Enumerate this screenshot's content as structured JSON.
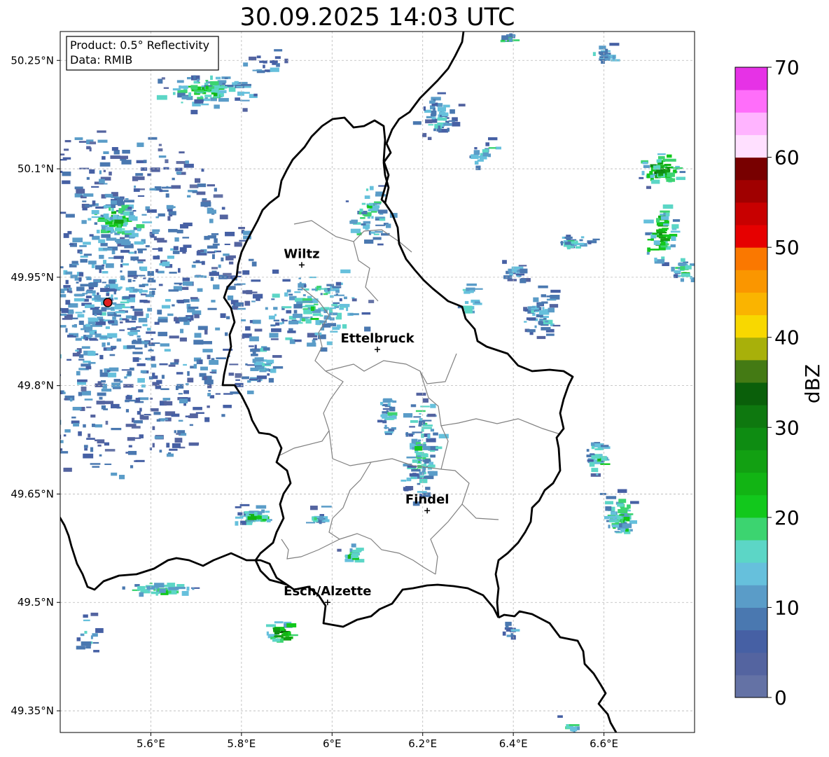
{
  "title": "30.09.2025 14:03 UTC",
  "info_box": {
    "product": "Product: 0.5° Reflectivity",
    "data": "Data: RMIB"
  },
  "map": {
    "lon_range": [
      5.4,
      6.8
    ],
    "lat_range": [
      49.32,
      50.29
    ],
    "lat_ticks": [
      {
        "value": 50.25,
        "label": "50.25°N"
      },
      {
        "value": 50.1,
        "label": "50.1°N"
      },
      {
        "value": 49.95,
        "label": "49.95°N"
      },
      {
        "value": 49.8,
        "label": "49.8°N"
      },
      {
        "value": 49.65,
        "label": "49.65°N"
      },
      {
        "value": 49.5,
        "label": "49.5°N"
      },
      {
        "value": 49.35,
        "label": "49.35°N"
      }
    ],
    "lon_ticks": [
      {
        "value": 5.6,
        "label": "5.6°E"
      },
      {
        "value": 5.8,
        "label": "5.8°E"
      },
      {
        "value": 6.0,
        "label": "6°E"
      },
      {
        "value": 6.2,
        "label": "6.2°E"
      },
      {
        "value": 6.4,
        "label": "6.4°E"
      },
      {
        "value": 6.6,
        "label": "6.6°E"
      }
    ],
    "gridlines": true,
    "radar_site": {
      "lon": 5.505,
      "lat": 49.915,
      "color": "#e02020"
    },
    "cities": [
      {
        "name": "Wiltz",
        "lon": 5.933,
        "lat": 49.967
      },
      {
        "name": "Ettelbruck",
        "lon": 6.1,
        "lat": 49.85
      },
      {
        "name": "Findel",
        "lon": 6.21,
        "lat": 49.627
      },
      {
        "name": "Esch/Alzette",
        "lon": 5.99,
        "lat": 49.5
      }
    ]
  },
  "colorbar": {
    "label": "dBZ",
    "min": 0,
    "max": 70,
    "ticks": [
      {
        "value": 0,
        "label": "0"
      },
      {
        "value": 10,
        "label": "10"
      },
      {
        "value": 20,
        "label": "20"
      },
      {
        "value": 30,
        "label": "30"
      },
      {
        "value": 40,
        "label": "40"
      },
      {
        "value": 50,
        "label": "50"
      },
      {
        "value": 60,
        "label": "60"
      },
      {
        "value": 70,
        "label": "70"
      }
    ],
    "colors": [
      "#6472a5",
      "#5464a0",
      "#4660a4",
      "#4a78b0",
      "#5a9cc8",
      "#66c0dc",
      "#5cd6c6",
      "#3cd470",
      "#12c81c",
      "#12b414",
      "#12a012",
      "#0e8c12",
      "#0e780f",
      "#0a5f0a",
      "#447a14",
      "#a8b00a",
      "#f8d800",
      "#fab400",
      "#fa9600",
      "#fa7800",
      "#e60000",
      "#c80000",
      "#a00000",
      "#780000",
      "#ffe0ff",
      "#ffb4ff",
      "#ff6efa",
      "#e632e6"
    ]
  },
  "echo_clusters": [
    {
      "lon": 5.505,
      "lat": 49.915,
      "r_lon": 0.33,
      "r_lat": 0.24,
      "count": 1100,
      "intensity": 0.15,
      "min_r": 0.25
    },
    {
      "lon": 5.72,
      "lat": 50.21,
      "r_lon": 0.12,
      "r_lat": 0.03,
      "count": 110,
      "intensity": 0.35
    },
    {
      "lon": 5.52,
      "lat": 50.03,
      "r_lon": 0.08,
      "r_lat": 0.04,
      "count": 70,
      "intensity": 0.4
    },
    {
      "lon": 5.95,
      "lat": 49.91,
      "r_lon": 0.14,
      "r_lat": 0.07,
      "count": 140,
      "intensity": 0.3
    },
    {
      "lon": 6.08,
      "lat": 50.04,
      "r_lon": 0.06,
      "r_lat": 0.06,
      "count": 60,
      "intensity": 0.35
    },
    {
      "lon": 6.23,
      "lat": 50.17,
      "r_lon": 0.06,
      "r_lat": 0.04,
      "count": 50,
      "intensity": 0.2
    },
    {
      "lon": 5.84,
      "lat": 49.83,
      "r_lon": 0.05,
      "r_lat": 0.05,
      "count": 45,
      "intensity": 0.2
    },
    {
      "lon": 5.82,
      "lat": 49.62,
      "r_lon": 0.05,
      "r_lat": 0.02,
      "count": 45,
      "intensity": 0.4
    },
    {
      "lon": 6.19,
      "lat": 49.71,
      "r_lon": 0.05,
      "r_lat": 0.1,
      "count": 110,
      "intensity": 0.3
    },
    {
      "lon": 6.12,
      "lat": 49.76,
      "r_lon": 0.03,
      "r_lat": 0.04,
      "count": 30,
      "intensity": 0.25
    },
    {
      "lon": 6.72,
      "lat": 50.1,
      "r_lon": 0.06,
      "r_lat": 0.03,
      "count": 70,
      "intensity": 0.6
    },
    {
      "lon": 6.72,
      "lat": 50.01,
      "r_lon": 0.04,
      "r_lat": 0.05,
      "count": 60,
      "intensity": 0.55
    },
    {
      "lon": 6.77,
      "lat": 49.96,
      "r_lon": 0.03,
      "r_lat": 0.03,
      "count": 25,
      "intensity": 0.35
    },
    {
      "lon": 6.63,
      "lat": 49.62,
      "r_lon": 0.05,
      "r_lat": 0.04,
      "count": 60,
      "intensity": 0.4
    },
    {
      "lon": 6.58,
      "lat": 49.7,
      "r_lon": 0.03,
      "r_lat": 0.03,
      "count": 30,
      "intensity": 0.4
    },
    {
      "lon": 6.45,
      "lat": 49.9,
      "r_lon": 0.06,
      "r_lat": 0.05,
      "count": 55,
      "intensity": 0.2
    },
    {
      "lon": 6.53,
      "lat": 50.0,
      "r_lon": 0.05,
      "r_lat": 0.015,
      "count": 25,
      "intensity": 0.25
    },
    {
      "lon": 6.4,
      "lat": 49.96,
      "r_lon": 0.03,
      "r_lat": 0.02,
      "count": 20,
      "intensity": 0.15
    },
    {
      "lon": 6.33,
      "lat": 50.12,
      "r_lon": 0.04,
      "r_lat": 0.03,
      "count": 20,
      "intensity": 0.3
    },
    {
      "lon": 6.6,
      "lat": 50.26,
      "r_lon": 0.04,
      "r_lat": 0.02,
      "count": 20,
      "intensity": 0.3
    },
    {
      "lon": 6.38,
      "lat": 50.28,
      "r_lon": 0.03,
      "r_lat": 0.01,
      "count": 12,
      "intensity": 0.4
    },
    {
      "lon": 6.04,
      "lat": 49.57,
      "r_lon": 0.03,
      "r_lat": 0.02,
      "count": 20,
      "intensity": 0.4
    },
    {
      "lon": 5.88,
      "lat": 49.46,
      "r_lon": 0.05,
      "r_lat": 0.02,
      "count": 30,
      "intensity": 0.65
    },
    {
      "lon": 5.62,
      "lat": 49.52,
      "r_lon": 0.1,
      "r_lat": 0.015,
      "count": 40,
      "intensity": 0.35
    },
    {
      "lon": 6.39,
      "lat": 49.46,
      "r_lon": 0.02,
      "r_lat": 0.02,
      "count": 10,
      "intensity": 0.15
    },
    {
      "lon": 6.52,
      "lat": 49.33,
      "r_lon": 0.03,
      "r_lat": 0.015,
      "count": 10,
      "intensity": 0.3
    },
    {
      "lon": 5.96,
      "lat": 49.62,
      "r_lon": 0.03,
      "r_lat": 0.02,
      "count": 15,
      "intensity": 0.25
    },
    {
      "lon": 6.3,
      "lat": 49.92,
      "r_lon": 0.03,
      "r_lat": 0.03,
      "count": 15,
      "intensity": 0.35
    },
    {
      "lon": 5.45,
      "lat": 49.45,
      "r_lon": 0.05,
      "r_lat": 0.05,
      "count": 15,
      "intensity": 0.2
    },
    {
      "lon": 5.85,
      "lat": 50.25,
      "r_lon": 0.06,
      "r_lat": 0.03,
      "count": 18,
      "intensity": 0.15
    }
  ]
}
